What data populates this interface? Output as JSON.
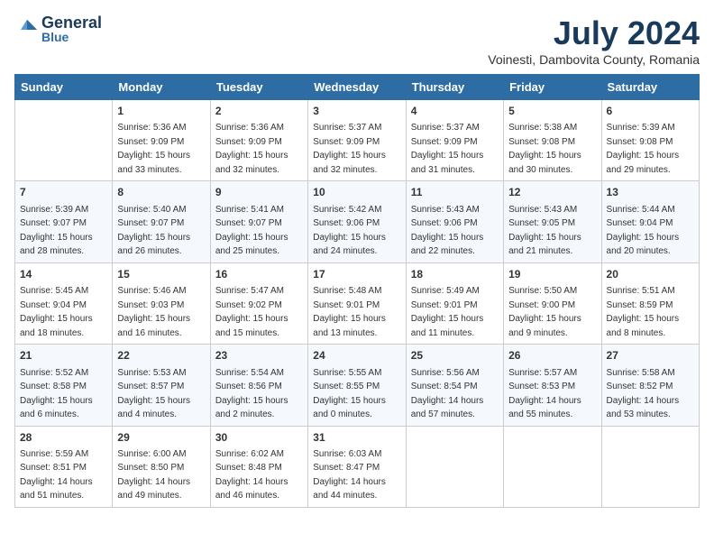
{
  "header": {
    "logo_line1": "General",
    "logo_line2": "Blue",
    "month_title": "July 2024",
    "location": "Voinesti, Dambovita County, Romania"
  },
  "weekdays": [
    "Sunday",
    "Monday",
    "Tuesday",
    "Wednesday",
    "Thursday",
    "Friday",
    "Saturday"
  ],
  "weeks": [
    [
      {
        "day": "",
        "info": ""
      },
      {
        "day": "1",
        "info": "Sunrise: 5:36 AM\nSunset: 9:09 PM\nDaylight: 15 hours\nand 33 minutes."
      },
      {
        "day": "2",
        "info": "Sunrise: 5:36 AM\nSunset: 9:09 PM\nDaylight: 15 hours\nand 32 minutes."
      },
      {
        "day": "3",
        "info": "Sunrise: 5:37 AM\nSunset: 9:09 PM\nDaylight: 15 hours\nand 32 minutes."
      },
      {
        "day": "4",
        "info": "Sunrise: 5:37 AM\nSunset: 9:09 PM\nDaylight: 15 hours\nand 31 minutes."
      },
      {
        "day": "5",
        "info": "Sunrise: 5:38 AM\nSunset: 9:08 PM\nDaylight: 15 hours\nand 30 minutes."
      },
      {
        "day": "6",
        "info": "Sunrise: 5:39 AM\nSunset: 9:08 PM\nDaylight: 15 hours\nand 29 minutes."
      }
    ],
    [
      {
        "day": "7",
        "info": "Sunrise: 5:39 AM\nSunset: 9:07 PM\nDaylight: 15 hours\nand 28 minutes."
      },
      {
        "day": "8",
        "info": "Sunrise: 5:40 AM\nSunset: 9:07 PM\nDaylight: 15 hours\nand 26 minutes."
      },
      {
        "day": "9",
        "info": "Sunrise: 5:41 AM\nSunset: 9:07 PM\nDaylight: 15 hours\nand 25 minutes."
      },
      {
        "day": "10",
        "info": "Sunrise: 5:42 AM\nSunset: 9:06 PM\nDaylight: 15 hours\nand 24 minutes."
      },
      {
        "day": "11",
        "info": "Sunrise: 5:43 AM\nSunset: 9:06 PM\nDaylight: 15 hours\nand 22 minutes."
      },
      {
        "day": "12",
        "info": "Sunrise: 5:43 AM\nSunset: 9:05 PM\nDaylight: 15 hours\nand 21 minutes."
      },
      {
        "day": "13",
        "info": "Sunrise: 5:44 AM\nSunset: 9:04 PM\nDaylight: 15 hours\nand 20 minutes."
      }
    ],
    [
      {
        "day": "14",
        "info": "Sunrise: 5:45 AM\nSunset: 9:04 PM\nDaylight: 15 hours\nand 18 minutes."
      },
      {
        "day": "15",
        "info": "Sunrise: 5:46 AM\nSunset: 9:03 PM\nDaylight: 15 hours\nand 16 minutes."
      },
      {
        "day": "16",
        "info": "Sunrise: 5:47 AM\nSunset: 9:02 PM\nDaylight: 15 hours\nand 15 minutes."
      },
      {
        "day": "17",
        "info": "Sunrise: 5:48 AM\nSunset: 9:01 PM\nDaylight: 15 hours\nand 13 minutes."
      },
      {
        "day": "18",
        "info": "Sunrise: 5:49 AM\nSunset: 9:01 PM\nDaylight: 15 hours\nand 11 minutes."
      },
      {
        "day": "19",
        "info": "Sunrise: 5:50 AM\nSunset: 9:00 PM\nDaylight: 15 hours\nand 9 minutes."
      },
      {
        "day": "20",
        "info": "Sunrise: 5:51 AM\nSunset: 8:59 PM\nDaylight: 15 hours\nand 8 minutes."
      }
    ],
    [
      {
        "day": "21",
        "info": "Sunrise: 5:52 AM\nSunset: 8:58 PM\nDaylight: 15 hours\nand 6 minutes."
      },
      {
        "day": "22",
        "info": "Sunrise: 5:53 AM\nSunset: 8:57 PM\nDaylight: 15 hours\nand 4 minutes."
      },
      {
        "day": "23",
        "info": "Sunrise: 5:54 AM\nSunset: 8:56 PM\nDaylight: 15 hours\nand 2 minutes."
      },
      {
        "day": "24",
        "info": "Sunrise: 5:55 AM\nSunset: 8:55 PM\nDaylight: 15 hours\nand 0 minutes."
      },
      {
        "day": "25",
        "info": "Sunrise: 5:56 AM\nSunset: 8:54 PM\nDaylight: 14 hours\nand 57 minutes."
      },
      {
        "day": "26",
        "info": "Sunrise: 5:57 AM\nSunset: 8:53 PM\nDaylight: 14 hours\nand 55 minutes."
      },
      {
        "day": "27",
        "info": "Sunrise: 5:58 AM\nSunset: 8:52 PM\nDaylight: 14 hours\nand 53 minutes."
      }
    ],
    [
      {
        "day": "28",
        "info": "Sunrise: 5:59 AM\nSunset: 8:51 PM\nDaylight: 14 hours\nand 51 minutes."
      },
      {
        "day": "29",
        "info": "Sunrise: 6:00 AM\nSunset: 8:50 PM\nDaylight: 14 hours\nand 49 minutes."
      },
      {
        "day": "30",
        "info": "Sunrise: 6:02 AM\nSunset: 8:48 PM\nDaylight: 14 hours\nand 46 minutes."
      },
      {
        "day": "31",
        "info": "Sunrise: 6:03 AM\nSunset: 8:47 PM\nDaylight: 14 hours\nand 44 minutes."
      },
      {
        "day": "",
        "info": ""
      },
      {
        "day": "",
        "info": ""
      },
      {
        "day": "",
        "info": ""
      }
    ]
  ]
}
